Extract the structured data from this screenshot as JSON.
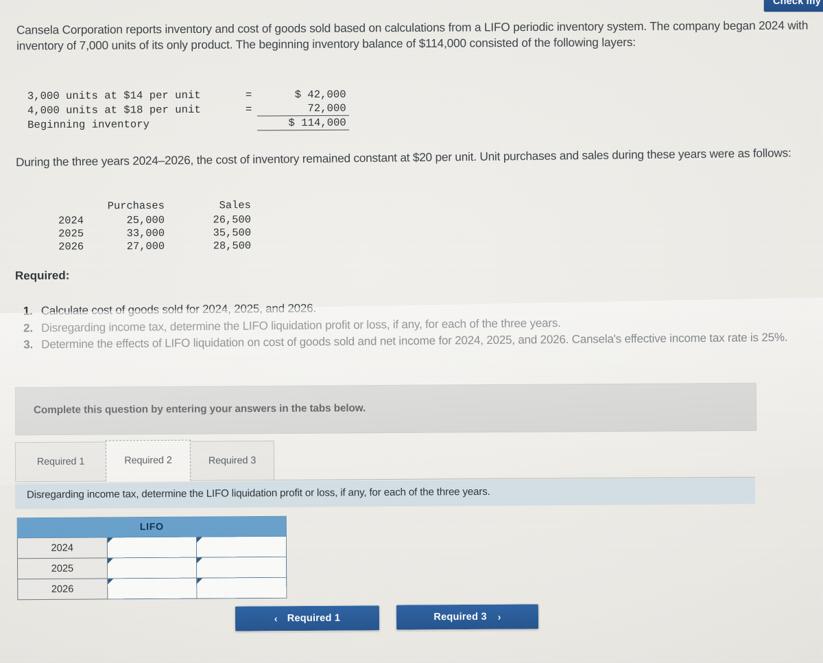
{
  "header": {
    "check_button_label": "Check my"
  },
  "problem": {
    "intro": "Cansela Corporation reports inventory and cost of goods sold based on calculations from a LIFO periodic inventory system. The company began 2024 with inventory of 7,000 units of its only product. The beginning inventory balance of $114,000 consisted of the following layers:",
    "layers": [
      {
        "description": "3,000 units at $14 per unit",
        "equals": "=",
        "amount": "$ 42,000"
      },
      {
        "description": "4,000 units at $18 per unit",
        "equals": "=",
        "amount": "72,000"
      },
      {
        "description": "Beginning inventory",
        "equals": "",
        "amount": "$ 114,000"
      }
    ],
    "paragraph2": "During the three years 2024–2026, the cost of inventory remained constant at $20 per unit. Unit purchases and sales during these years were as follows:",
    "units_table": {
      "columns": [
        "",
        "Purchases",
        "Sales"
      ],
      "rows": [
        {
          "year": "2024",
          "purchases": "25,000",
          "sales": "26,500"
        },
        {
          "year": "2025",
          "purchases": "33,000",
          "sales": "35,500"
        },
        {
          "year": "2026",
          "purchases": "27,000",
          "sales": "28,500"
        }
      ]
    },
    "required_label": "Required:",
    "required_items": [
      {
        "number": "1.",
        "text": "Calculate cost of goods sold for 2024, 2025, and 2026."
      },
      {
        "number": "2.",
        "text": "Disregarding income tax, determine the LIFO liquidation profit or loss, if any, for each of the three years."
      },
      {
        "number": "3.",
        "text": "Determine the effects of LIFO liquidation on cost of goods sold and net income for 2024, 2025, and 2026. Cansela's effective income tax rate is 25%."
      }
    ]
  },
  "answer_area": {
    "complete_banner": "Complete this question by entering your answers in the tabs below.",
    "tabs": [
      {
        "label": "Required 1",
        "active": false
      },
      {
        "label": "Required 2",
        "active": true
      },
      {
        "label": "Required 3",
        "active": false
      }
    ],
    "instruction": "Disregarding income tax, determine the LIFO liquidation profit or loss, if any, for each of the three years.",
    "lifo_table": {
      "header": "LIFO",
      "rows": [
        {
          "year": "2024",
          "value_a": "",
          "value_b": ""
        },
        {
          "year": "2025",
          "value_a": "",
          "value_b": ""
        },
        {
          "year": "2026",
          "value_a": "",
          "value_b": ""
        }
      ]
    },
    "nav": {
      "prev_chevron": "‹",
      "prev_label": "Required 1",
      "next_label": "Required 3",
      "next_chevron": "›"
    }
  },
  "colors": {
    "accent_blue": "#2f64a4",
    "table_header_blue": "#6aa2cd",
    "instruction_band": "#d4e0e6",
    "gray_band": "#cfd0cc"
  }
}
